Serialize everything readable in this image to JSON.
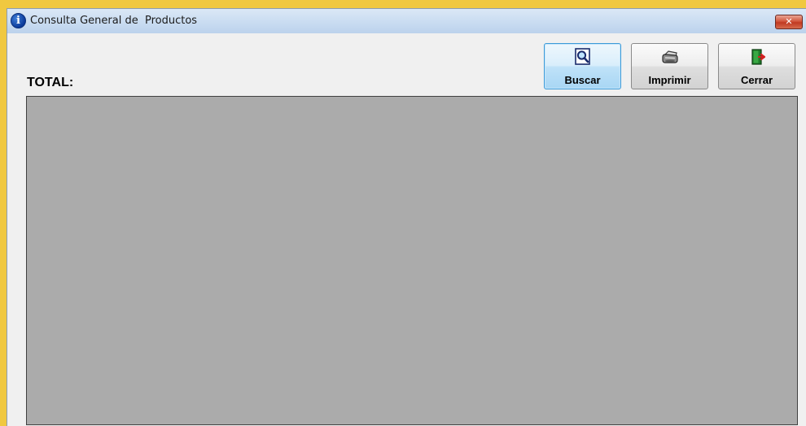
{
  "window": {
    "title": "Consulta General de  Productos",
    "close_glyph": "✕",
    "title_icon_glyph": "i"
  },
  "toolbar": {
    "buttons": [
      {
        "label": "Buscar",
        "icon": "search-icon"
      },
      {
        "label": "Imprimir",
        "icon": "printer-icon"
      },
      {
        "label": "Cerrar",
        "icon": "exit-door-icon"
      }
    ]
  },
  "main": {
    "total_label": "TOTAL:"
  },
  "colors": {
    "grid_background": "#ababab",
    "title_bar": "#c9dcf1",
    "close_button": "#c8452c",
    "focus_border": "#3c9ad8"
  }
}
